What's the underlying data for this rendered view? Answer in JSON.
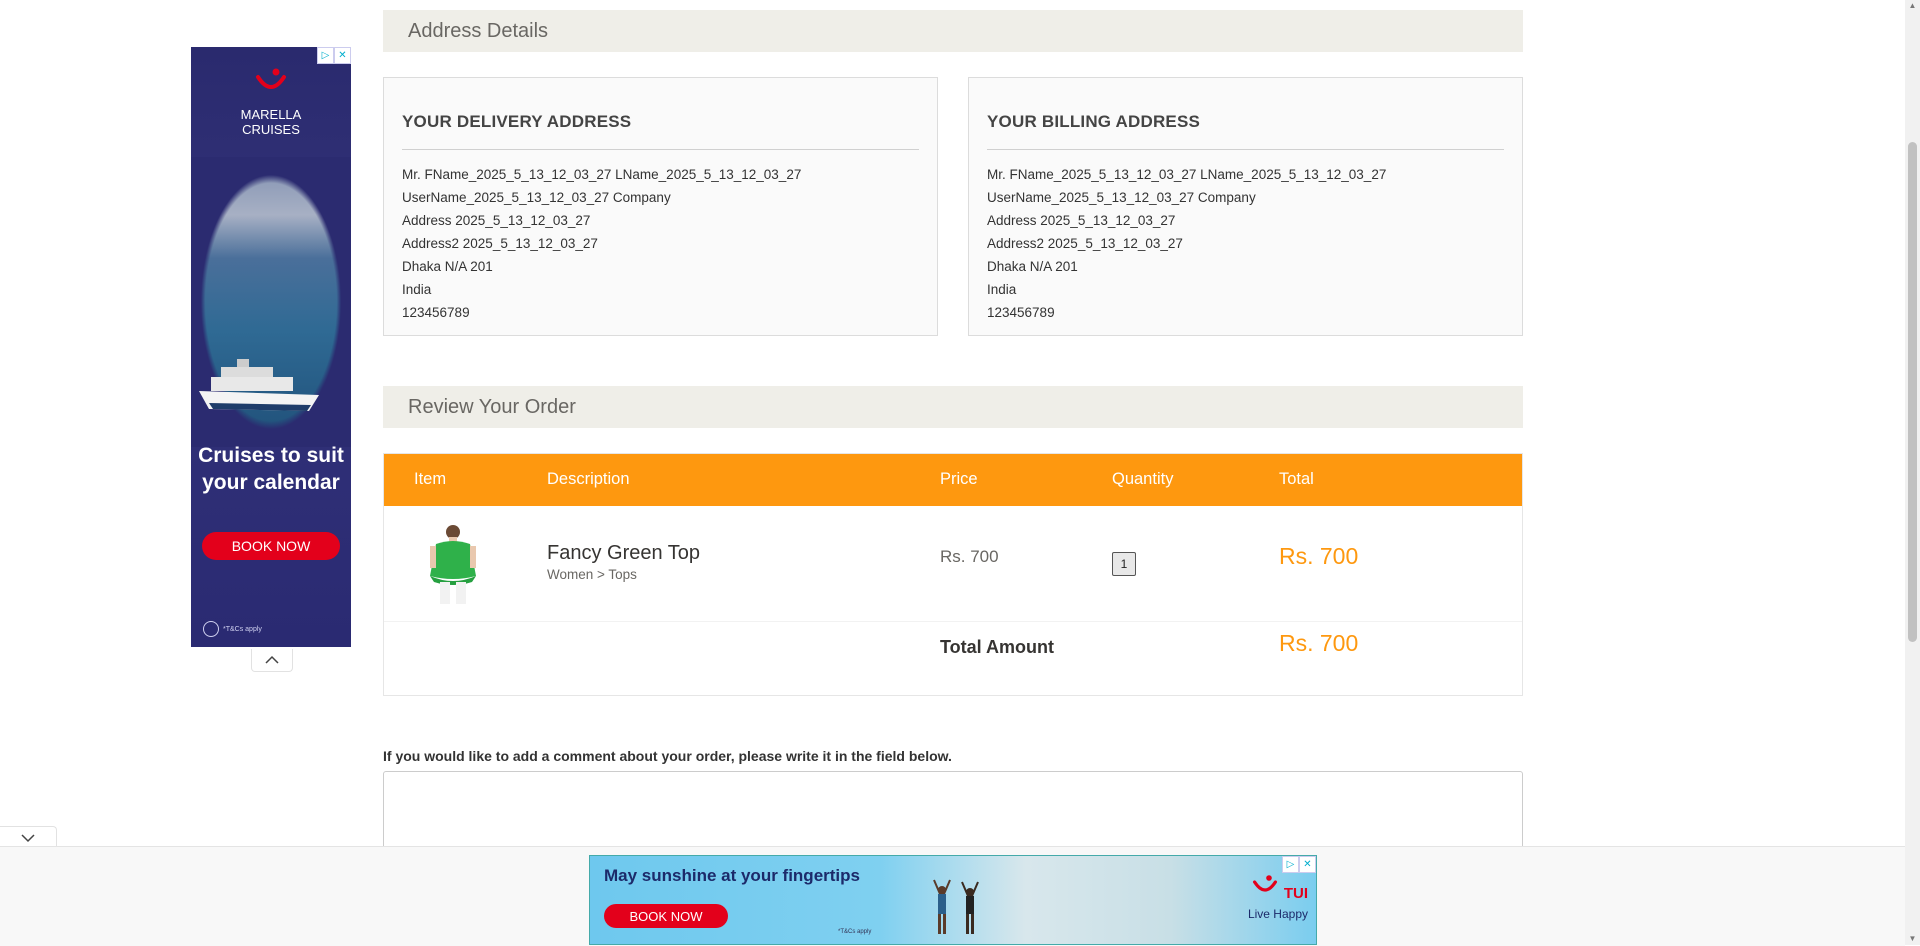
{
  "address_section": {
    "title": "Address Details"
  },
  "delivery": {
    "heading": "YOUR DELIVERY ADDRESS",
    "lines": [
      "Mr. FName_2025_5_13_12_03_27 LName_2025_5_13_12_03_27",
      "UserName_2025_5_13_12_03_27 Company",
      "Address 2025_5_13_12_03_27",
      "Address2 2025_5_13_12_03_27",
      "Dhaka N/A 201",
      "India",
      "123456789"
    ]
  },
  "billing": {
    "heading": "YOUR BILLING ADDRESS",
    "lines": [
      "Mr. FName_2025_5_13_12_03_27 LName_2025_5_13_12_03_27",
      "UserName_2025_5_13_12_03_27 Company",
      "Address 2025_5_13_12_03_27",
      "Address2 2025_5_13_12_03_27",
      "Dhaka N/A 201",
      "India",
      "123456789"
    ]
  },
  "review_section": {
    "title": "Review Your Order"
  },
  "order_table": {
    "headers": {
      "item": "Item",
      "description": "Description",
      "price": "Price",
      "quantity": "Quantity",
      "total": "Total"
    },
    "product": {
      "name": "Fancy Green Top",
      "category": "Women > Tops",
      "price": "Rs. 700",
      "quantity": "1",
      "total": "Rs. 700"
    },
    "total_label": "Total Amount",
    "total_amount": "Rs. 700"
  },
  "comment": {
    "label": "If you would like to add a comment about your order, please write it in the field below.",
    "value": ""
  },
  "left_ad": {
    "brand_line1": "MARELLA",
    "brand_line2": "CRUISES",
    "headline": "Cruises to suit your calendar",
    "button": "BOOK NOW",
    "footnote": "*T&Cs apply"
  },
  "bottom_ad": {
    "headline": "May sunshine at your fingertips",
    "button": "BOOK NOW",
    "footnote": "*T&Cs apply",
    "brand": "TUI",
    "tagline": "Live Happy"
  },
  "colors": {
    "accent": "#fe980f",
    "section_bg": "#efeee8",
    "ad_button": "#e3001b"
  }
}
